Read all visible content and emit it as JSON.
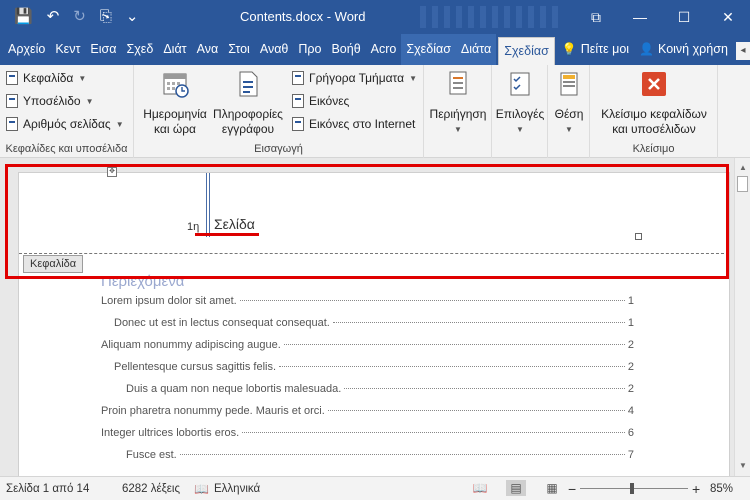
{
  "title_bar": {
    "title": "Contents.docx - Word",
    "qat": {
      "save_icon": "💾",
      "undo_icon": "↶",
      "redo_icon": "↻",
      "copy_icon": "⎘",
      "more_icon": "⌄"
    },
    "buttons": {
      "restore": "⧉",
      "minimize": "—",
      "maximize": "☐",
      "close": "✕"
    }
  },
  "tabs": [
    "Αρχείο",
    "Κεντ",
    "Εισα",
    "Σχεδ",
    "Διάτ",
    "Ανα",
    "Στοι",
    "Αναθ",
    "Προ",
    "Βοήθ",
    "Acro",
    "Σχεδίασ",
    "Διάτα"
  ],
  "active_tab": "Σχεδίασ",
  "tell_me": "Πείτε μοι",
  "share": "Κοινή χρήση",
  "ribbon": {
    "header_footer_group": {
      "label": "Κεφαλίδες και υποσέλιδα",
      "header": "Κεφαλίδα",
      "footer": "Υποσέλιδο",
      "page_number": "Αριθμός σελίδας"
    },
    "insert_group": {
      "label": "Εισαγωγή",
      "date_time_line1": "Ημερομηνία",
      "date_time_line2": "και ώρα",
      "doc_info_line1": "Πληροφορίες",
      "doc_info_line2": "εγγράφου",
      "quick_parts": "Γρήγορα Τμήματα",
      "pictures": "Εικόνες",
      "online_pictures": "Εικόνες στο Internet"
    },
    "navigation": "Περιήγηση",
    "options": "Επιλογές",
    "position": "Θέση",
    "close_group": {
      "label": "Κλείσιμο",
      "close_line1": "Κλείσιμο κεφαλίδων",
      "close_line2": "και υποσέλιδων"
    }
  },
  "document": {
    "header_page_number": "1η",
    "header_text": "Σελίδα",
    "header_tag": "Κεφαλίδα",
    "toc_title": "Περιεχόμενα",
    "toc": [
      {
        "text": "Lorem ipsum dolor sit amet.",
        "page": "1",
        "level": 1
      },
      {
        "text": "Donec ut est in lectus consequat consequat.",
        "page": "1",
        "level": 2
      },
      {
        "text": "Aliquam nonummy adipiscing augue.",
        "page": "2",
        "level": 1
      },
      {
        "text": "Pellentesque cursus sagittis felis.",
        "page": "2",
        "level": 2
      },
      {
        "text": "Duis a quam non neque lobortis malesuada.",
        "page": "2",
        "level": 3
      },
      {
        "text": "Proin pharetra nonummy pede. Mauris et orci.",
        "page": "4",
        "level": 1
      },
      {
        "text": "Integer ultrices lobortis eros.",
        "page": "6",
        "level": 1
      },
      {
        "text": "Fusce est.",
        "page": "7",
        "level": 3
      }
    ]
  },
  "status_bar": {
    "page": "Σελίδα 1 από 14",
    "words": "6282 λέξεις",
    "language": "Ελληνικά",
    "zoom_minus": "−",
    "zoom_plus": "+",
    "zoom": "85%"
  },
  "colors": {
    "accent": "#2b579a",
    "highlight_box": "#e00000",
    "close_icon": "#d9472b"
  }
}
